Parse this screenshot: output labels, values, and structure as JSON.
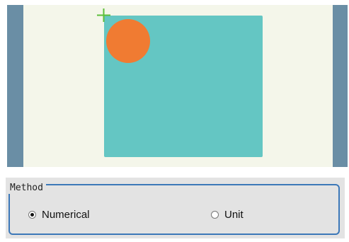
{
  "method_group": {
    "title": "Method",
    "options": [
      {
        "label": "Numerical",
        "selected": true
      },
      {
        "label": "Unit",
        "selected": false
      }
    ]
  },
  "colors": {
    "background": "#f4f6ea",
    "side_bars": "#6a8ea5",
    "rectangle": "#64c6c3",
    "circle": "#f07b32",
    "crosshair": "#5cbf3a",
    "group_border": "#3c78b8"
  },
  "icons": {
    "crosshair": "crosshair-icon"
  }
}
